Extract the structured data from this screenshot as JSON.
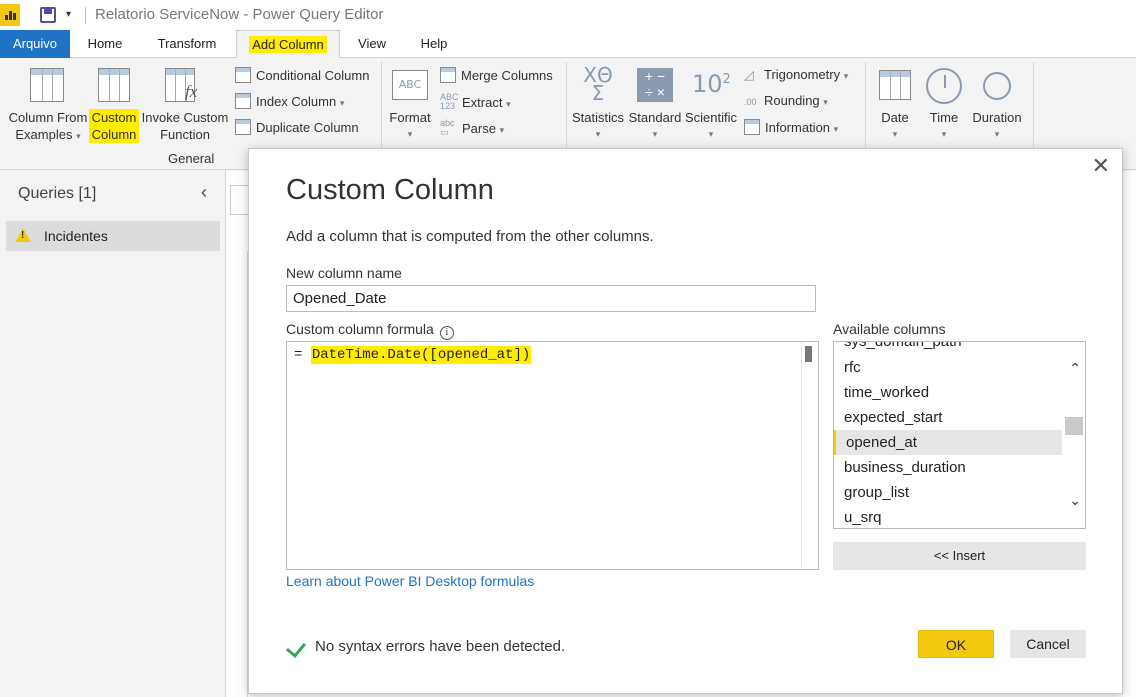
{
  "window": {
    "title": "Relatorio ServiceNow - Power Query Editor"
  },
  "tabs": [
    {
      "label": "Arquivo"
    },
    {
      "label": "Home"
    },
    {
      "label": "Transform"
    },
    {
      "label": "Add Column"
    },
    {
      "label": "View"
    },
    {
      "label": "Help"
    }
  ],
  "active_tab": "Add Column",
  "ribbon": {
    "general": {
      "label": "General",
      "column_from_examples": [
        "Column From",
        "Examples"
      ],
      "custom_column": [
        "Custom",
        "Column"
      ],
      "invoke_custom_function": [
        "Invoke Custom",
        "Function"
      ],
      "conditional_column": "Conditional Column",
      "index_column": "Index Column",
      "duplicate_column": "Duplicate Column"
    },
    "from_text": {
      "format": "Format",
      "merge_columns": "Merge Columns",
      "extract": "Extract",
      "parse": "Parse"
    },
    "from_number": {
      "statistics": "Statistics",
      "standard": "Standard",
      "scientific": "Scientific",
      "trigonometry": "Trigonometry",
      "rounding": "Rounding",
      "information": "Information"
    },
    "from_date_time": {
      "date": "Date",
      "time": "Time",
      "duration": "Duration"
    }
  },
  "queries": {
    "title": "Queries [1]",
    "items": [
      {
        "name": "Incidentes",
        "status": "warning"
      }
    ]
  },
  "dialog": {
    "title": "Custom Column",
    "subtitle": "Add a column that is computed from the other columns.",
    "new_column_label": "New column name",
    "new_column_value": "Opened_Date",
    "formula_label": "Custom column formula",
    "formula_prefix": "= ",
    "formula_code": "DateTime.Date([opened_at])",
    "available_label": "Available columns",
    "available_columns": [
      "sys_domain_path",
      "rfc",
      "time_worked",
      "expected_start",
      "opened_at",
      "business_duration",
      "group_list",
      "u_srq"
    ],
    "selected_column": "opened_at",
    "insert_label": "<< Insert",
    "learn_link": "Learn about Power BI Desktop formulas",
    "status": "No syntax errors have been detected.",
    "ok_label": "OK",
    "cancel_label": "Cancel"
  },
  "colors": {
    "accent_yellow": "#f2c811",
    "file_tab_blue": "#1e73c6",
    "link_blue": "#1e73c6",
    "check_green": "#3aa55c"
  }
}
